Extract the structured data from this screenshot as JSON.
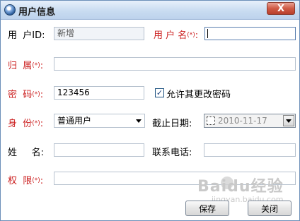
{
  "window": {
    "title": "用户信息",
    "close_label": "X"
  },
  "form": {
    "user_id": {
      "label": "用  户ID:",
      "value": "新增"
    },
    "user_name": {
      "label": "用 户 名",
      "required_mark": "(*)",
      "colon": ":",
      "value": ""
    },
    "belong_to": {
      "label": "归  属",
      "required_mark": "(*)",
      "colon": ":",
      "value": ""
    },
    "password": {
      "label": "密  码",
      "required_mark": "(*)",
      "colon": ":",
      "value": "123456"
    },
    "allow_change_password": {
      "label": "允许其更改密码",
      "checked": true,
      "check_glyph": "✓"
    },
    "identity": {
      "label": "身  份",
      "required_mark": "(*)",
      "colon": ":",
      "value": "普通用户"
    },
    "expiry_date": {
      "label": "截止日期:",
      "value": "2010-11-17",
      "checked": false
    },
    "full_name": {
      "label": "姓     名:",
      "value": ""
    },
    "phone": {
      "label": "联系电话:",
      "value": ""
    },
    "permission": {
      "label": "权  限",
      "required_mark": "(*)",
      "colon": ":",
      "value": ""
    }
  },
  "buttons": {
    "save_label": "保存",
    "close_label": "关闭"
  },
  "watermark": {
    "main": "Baidu经验",
    "sub": "jingyan.baidu.com"
  },
  "colors": {
    "required_label": "#cc2222",
    "title_bar": "#c9dcf1",
    "close_button": "#cf5a44"
  },
  "icons": {
    "app": "app-globe-icon",
    "dropdown": "chevron-down-icon"
  }
}
